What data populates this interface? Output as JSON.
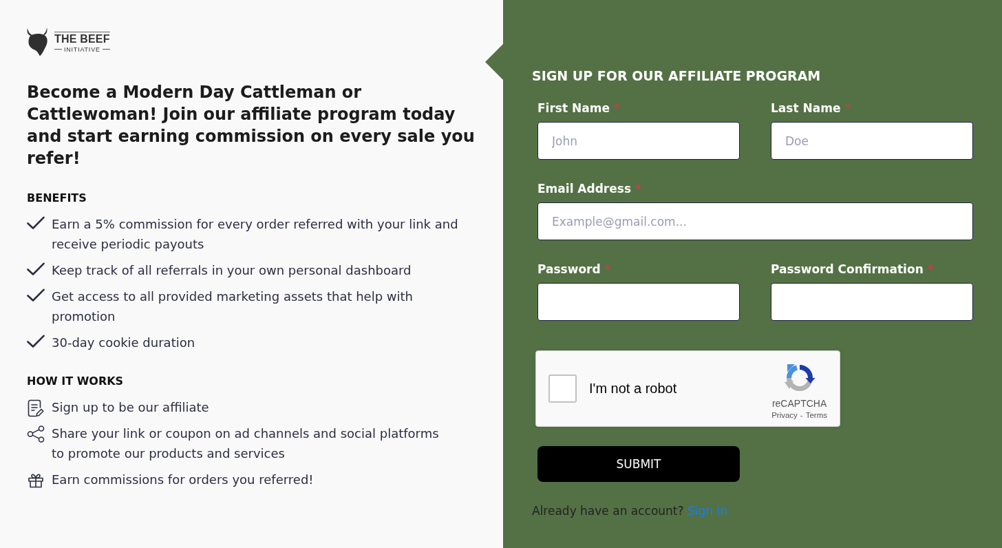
{
  "logo": {
    "name": "THE BEEF",
    "tagline": "INITIATIVE"
  },
  "intro": {
    "headline": "Become a Modern Day Cattleman or Cattlewoman! Join our affiliate program today and start earning commission on every sale you refer!"
  },
  "benefits": {
    "heading": "BENEFITS",
    "items": [
      "Earn a 5% commission for every order referred with your link and receive periodic payouts",
      "Keep track of all referrals in your own personal dashboard",
      "Get access to all provided marketing assets that help with promotion",
      "30-day cookie duration"
    ]
  },
  "how_it_works": {
    "heading": "HOW IT WORKS",
    "steps": [
      {
        "kind": "signup",
        "text": "Sign up to be our affiliate"
      },
      {
        "kind": "share",
        "text": "Share your link or coupon on ad channels and social platforms to promote our products and services"
      },
      {
        "kind": "gift",
        "text": "Earn commissions for orders you referred!"
      }
    ]
  },
  "signup_form": {
    "title": "SIGN UP FOR OUR AFFILIATE PROGRAM",
    "rows": [
      {
        "fields": [
          {
            "label": "First Name",
            "required_mark": "*",
            "placeholder": "John"
          },
          {
            "label": "Last Name",
            "required_mark": "*",
            "placeholder": "Doe"
          }
        ]
      },
      {
        "fields": [
          {
            "label": "Email Address",
            "required_mark": "*",
            "placeholder": "Example@gmail.com..."
          }
        ]
      },
      {
        "fields": [
          {
            "label": "Password",
            "required_mark": "*"
          },
          {
            "label": "Password Confirmation",
            "required_mark": "*"
          }
        ]
      }
    ],
    "captcha": {
      "checked": false,
      "label": "I'm not a robot",
      "brand": "reCAPTCHA",
      "privacy_link": "Privacy",
      "separator": "-",
      "terms_link": "Terms"
    },
    "submit_button": "SUBMIT",
    "sign_in": {
      "prompt": "Already have an account?",
      "link": "Sign in"
    }
  }
}
